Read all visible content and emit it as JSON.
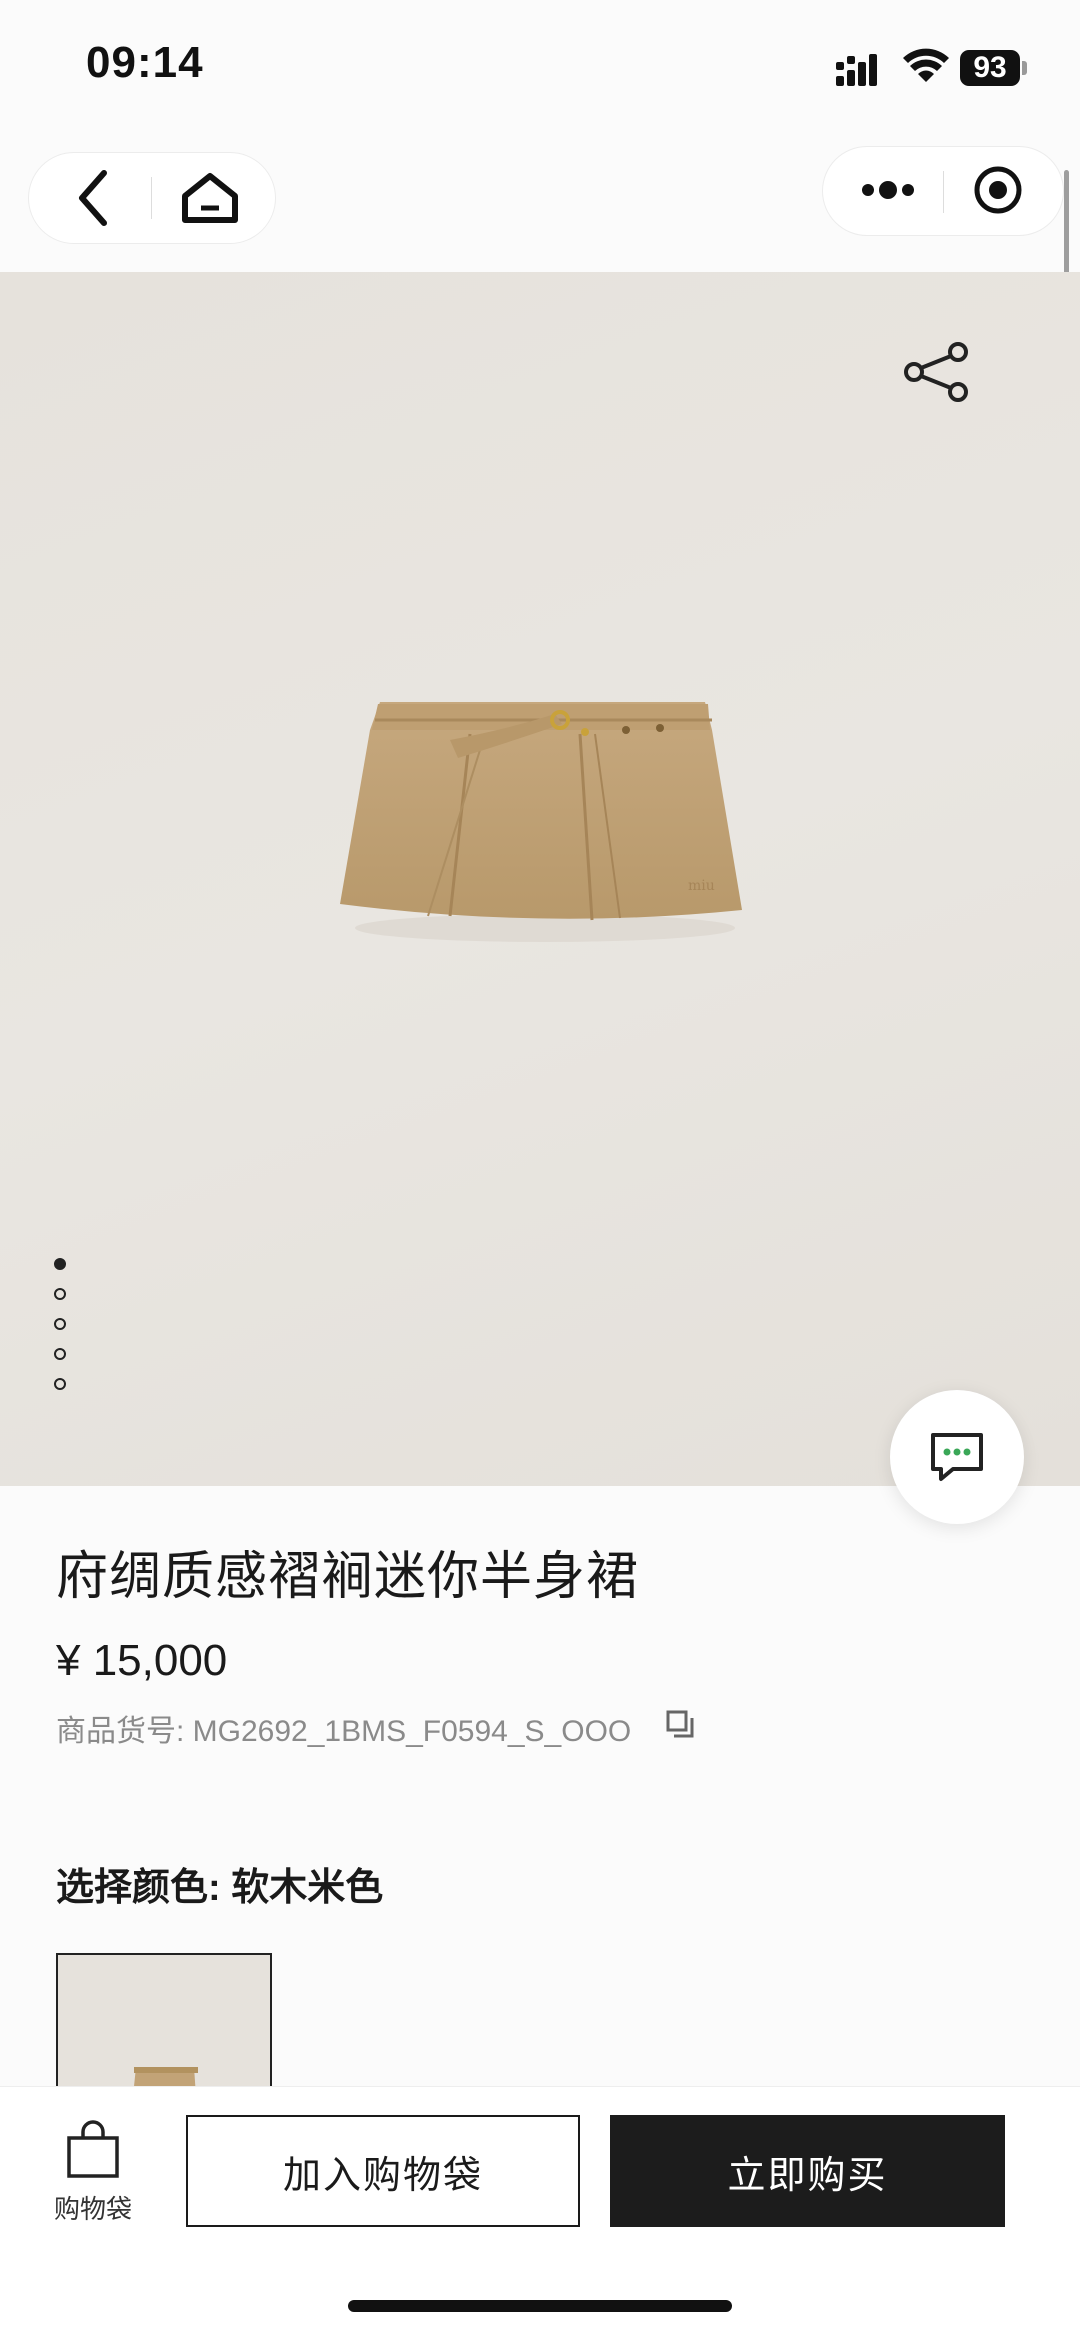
{
  "status_bar": {
    "time": "09:14",
    "battery": "93"
  },
  "nav": {
    "back_icon": "chevron-left-icon",
    "home_icon": "home-icon",
    "more_icon": "more-dots-icon",
    "target_icon": "target-icon"
  },
  "product": {
    "title": "府绸质感褶裥迷你半身裙",
    "price": "¥ 15,000",
    "sku": "商品货号: MG2692_1BMS_F0594_S_OOO",
    "color_label": "选择颜色: 软木米色",
    "image_count": 5,
    "active_image": 1
  },
  "bottom_bar": {
    "bag_label": "购物袋",
    "add_to_bag": "加入购物袋",
    "buy_now": "立即购买"
  },
  "colors": {
    "accent": "#1c1c1c",
    "hero_bg": "#e7e3dd",
    "skirt": "#c2a377"
  }
}
